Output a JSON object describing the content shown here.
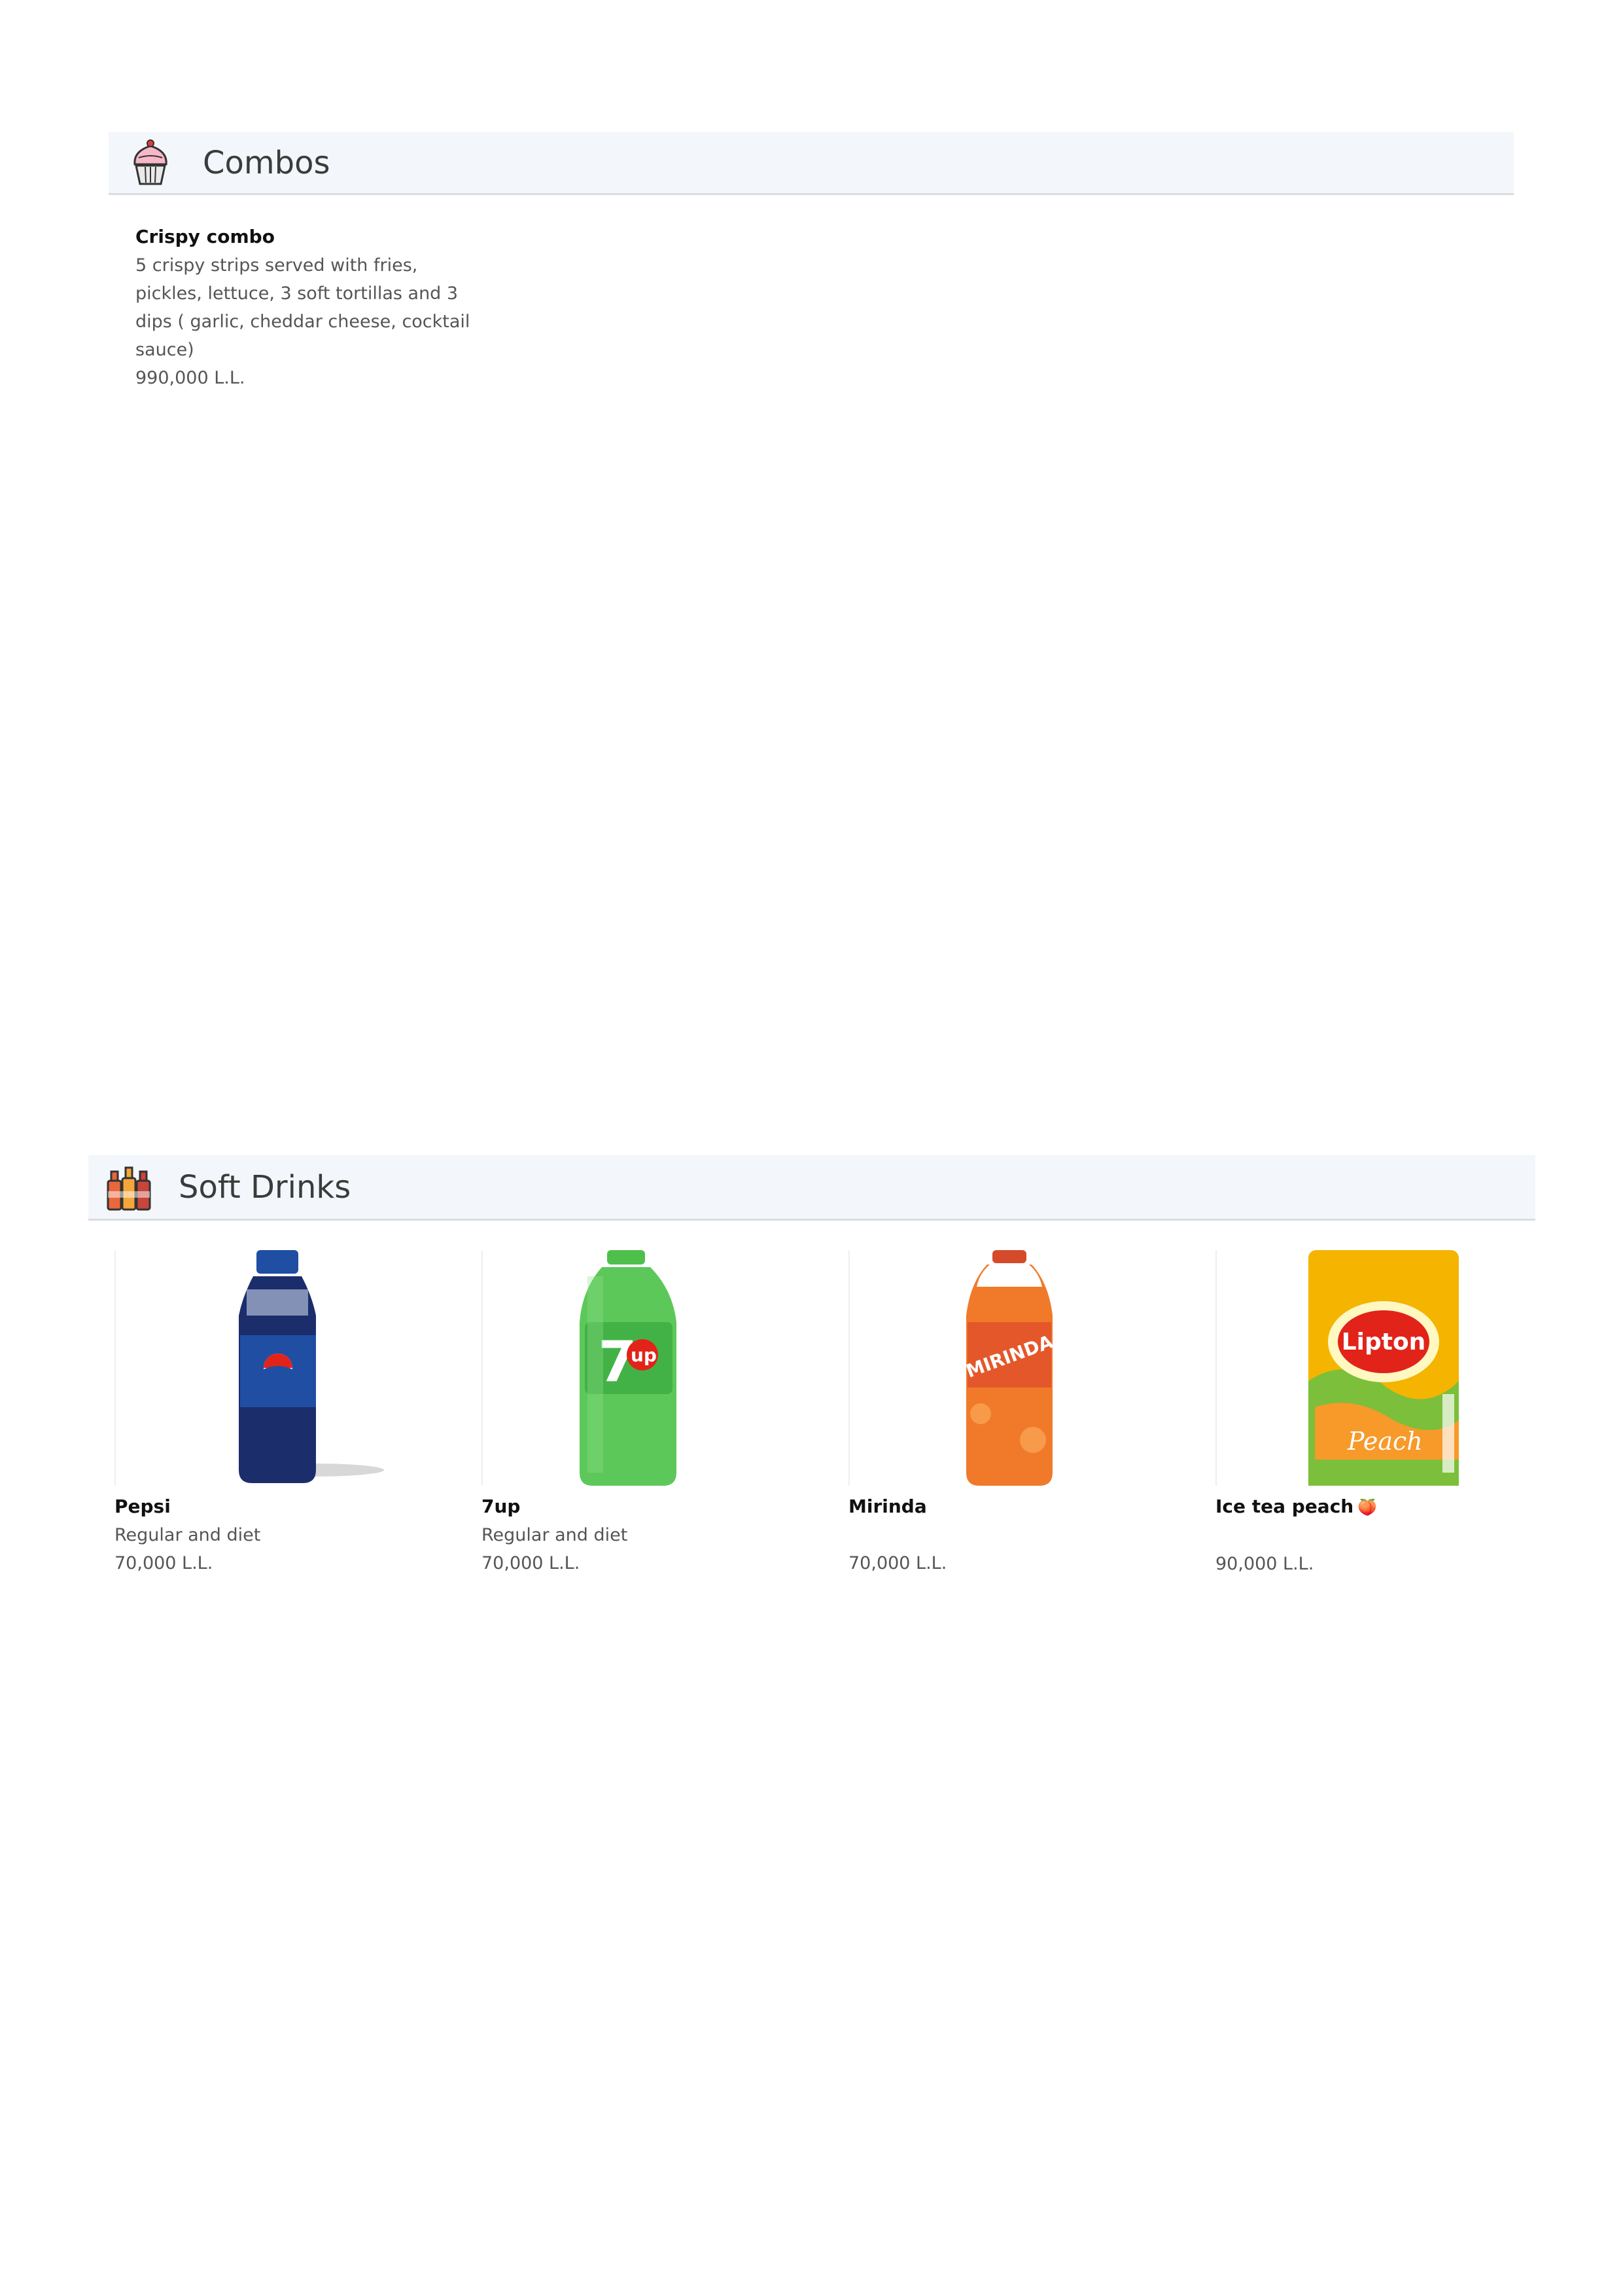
{
  "sections": {
    "combos": {
      "title": "Combos",
      "icon": "cupcake-icon",
      "items": [
        {
          "name": "Crispy combo",
          "description_lines": [
            "5 crispy strips served with fries,",
            "pickles, lettuce, 3 soft tortillas and 3",
            "dips ( garlic, cheddar cheese, cocktail",
            "sauce)"
          ],
          "price": "990,000 L.L."
        }
      ]
    },
    "soft_drinks": {
      "title": "Soft Drinks",
      "icon": "bottles-icon",
      "items": [
        {
          "name": "Pepsi",
          "description": "Regular and diet",
          "price": "70,000 L.L.",
          "image": "pepsi-bottle"
        },
        {
          "name": "7up",
          "description": "Regular and diet",
          "price": "70,000 L.L.",
          "image": "7up-bottle"
        },
        {
          "name": "Mirinda",
          "description": "",
          "price": "70,000 L.L.",
          "image": "mirinda-bottle"
        },
        {
          "name": "Ice tea peach",
          "name_emoji": "🍑",
          "description": "",
          "price": "90,000 L.L.",
          "image": "lipton-peach-can"
        }
      ]
    }
  },
  "colors": {
    "header_bg": "#f3f6fa",
    "header_border": "#d9dde2",
    "pepsi": "#1c2d6b",
    "sevenup": "#5cc85a",
    "mirinda": "#f07a2a",
    "lipton": "#f4b400"
  }
}
